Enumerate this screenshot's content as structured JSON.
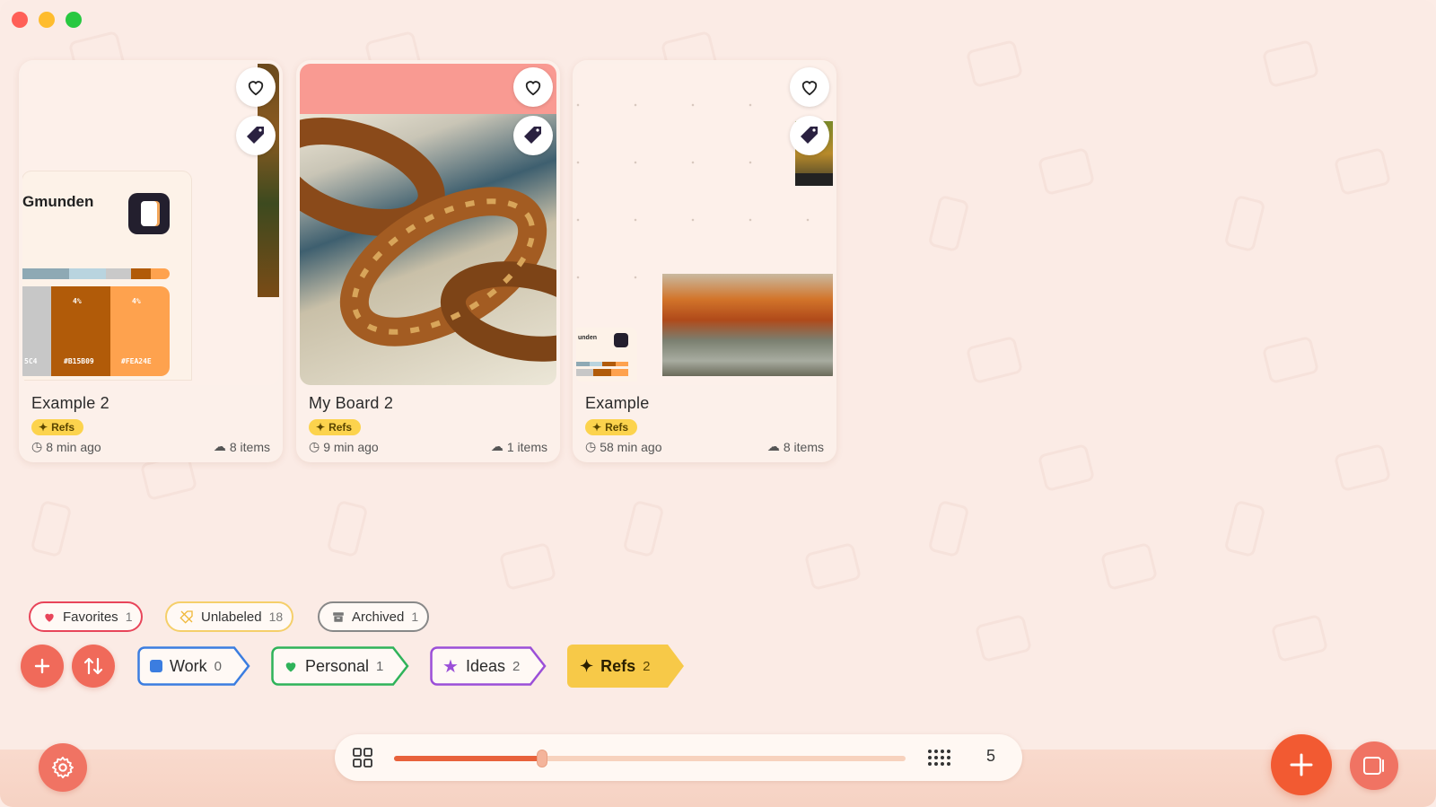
{
  "boards": [
    {
      "title": "Example 2",
      "label": "Refs",
      "time": "8 min ago",
      "items": "8 items",
      "preview": {
        "heading": "Gmunden",
        "pcts": [
          "4%",
          "4%"
        ],
        "codes": [
          "5C4",
          "#B15B09",
          "#FEA24E"
        ]
      }
    },
    {
      "title": "My Board 2",
      "label": "Refs",
      "time": "9 min ago",
      "items": "1 items"
    },
    {
      "title": "Example",
      "label": "Refs",
      "time": "58 min ago",
      "items": "8 items",
      "preview": {
        "heading": "unden"
      }
    }
  ],
  "filters": [
    {
      "label": "Favorites",
      "count": "1",
      "color": "#e8455a",
      "icon": "heart-icon"
    },
    {
      "label": "Unlabeled",
      "count": "18",
      "color": "#f5cf6a",
      "icon": "no-label-icon"
    },
    {
      "label": "Archived",
      "count": "1",
      "color": "#888888",
      "icon": "archive-icon"
    }
  ],
  "labels": [
    {
      "label": "Work",
      "count": "0",
      "color": "#3b7de0",
      "icon": "square-icon"
    },
    {
      "label": "Personal",
      "count": "1",
      "color": "#2fb35a",
      "icon": "heart-icon"
    },
    {
      "label": "Ideas",
      "count": "2",
      "color": "#9b4fd8",
      "icon": "star-icon"
    },
    {
      "label": "Refs",
      "count": "2",
      "color": "#f7c948",
      "icon": "sparkle-icon",
      "active": true
    }
  ],
  "zoom": {
    "value": "5",
    "fraction": 0.29
  },
  "colors": {
    "accent": "#f25a32",
    "button": "#f07363"
  }
}
